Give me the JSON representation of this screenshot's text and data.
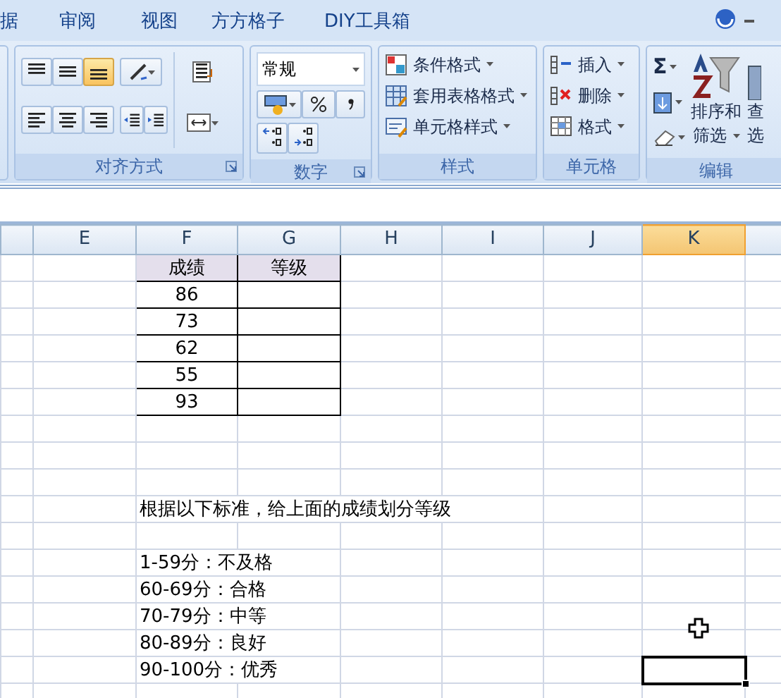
{
  "menu_tabs": [
    {
      "label": "据"
    },
    {
      "label": "审阅"
    },
    {
      "label": "视图"
    },
    {
      "label": "方方格子"
    },
    {
      "label": "DIY工具箱"
    }
  ],
  "ribbon": {
    "groups": [
      {
        "kind": "alignment",
        "label": "对齐方式",
        "vertical_align": [
          {
            "selected": false
          },
          {
            "selected": false
          },
          {
            "selected": true
          }
        ]
      },
      {
        "kind": "number",
        "label": "数字",
        "format": "常规"
      },
      {
        "kind": "styles",
        "label": "样式",
        "items": [
          "条件格式",
          "套用表格格式",
          "单元格样式"
        ]
      },
      {
        "kind": "cells",
        "label": "单元格",
        "items": [
          "插入",
          "删除",
          "格式"
        ]
      },
      {
        "kind": "editing",
        "label": "编辑",
        "sum_symbol": "Σ",
        "sort": [
          "排序和",
          "筛选"
        ],
        "find": [
          "查",
          "选"
        ]
      }
    ]
  },
  "sheet": {
    "columns": [
      {
        "label": "E",
        "selected": false
      },
      {
        "label": "F",
        "selected": false
      },
      {
        "label": "G",
        "selected": false
      },
      {
        "label": "H",
        "selected": false
      },
      {
        "label": "I",
        "selected": false
      },
      {
        "label": "J",
        "selected": false
      },
      {
        "label": "K",
        "selected": true
      }
    ],
    "score_table": {
      "headers": [
        "成绩",
        "等级"
      ],
      "scores": [
        "86",
        "73",
        "62",
        "55",
        "93"
      ]
    },
    "instruction": "根据以下标准，给上面的成绩划分等级",
    "criteria": [
      "1-59分：不及格",
      "60-69分：合格",
      "70-79分：中等",
      "80-89分：良好",
      "90-100分：优秀"
    ]
  }
}
